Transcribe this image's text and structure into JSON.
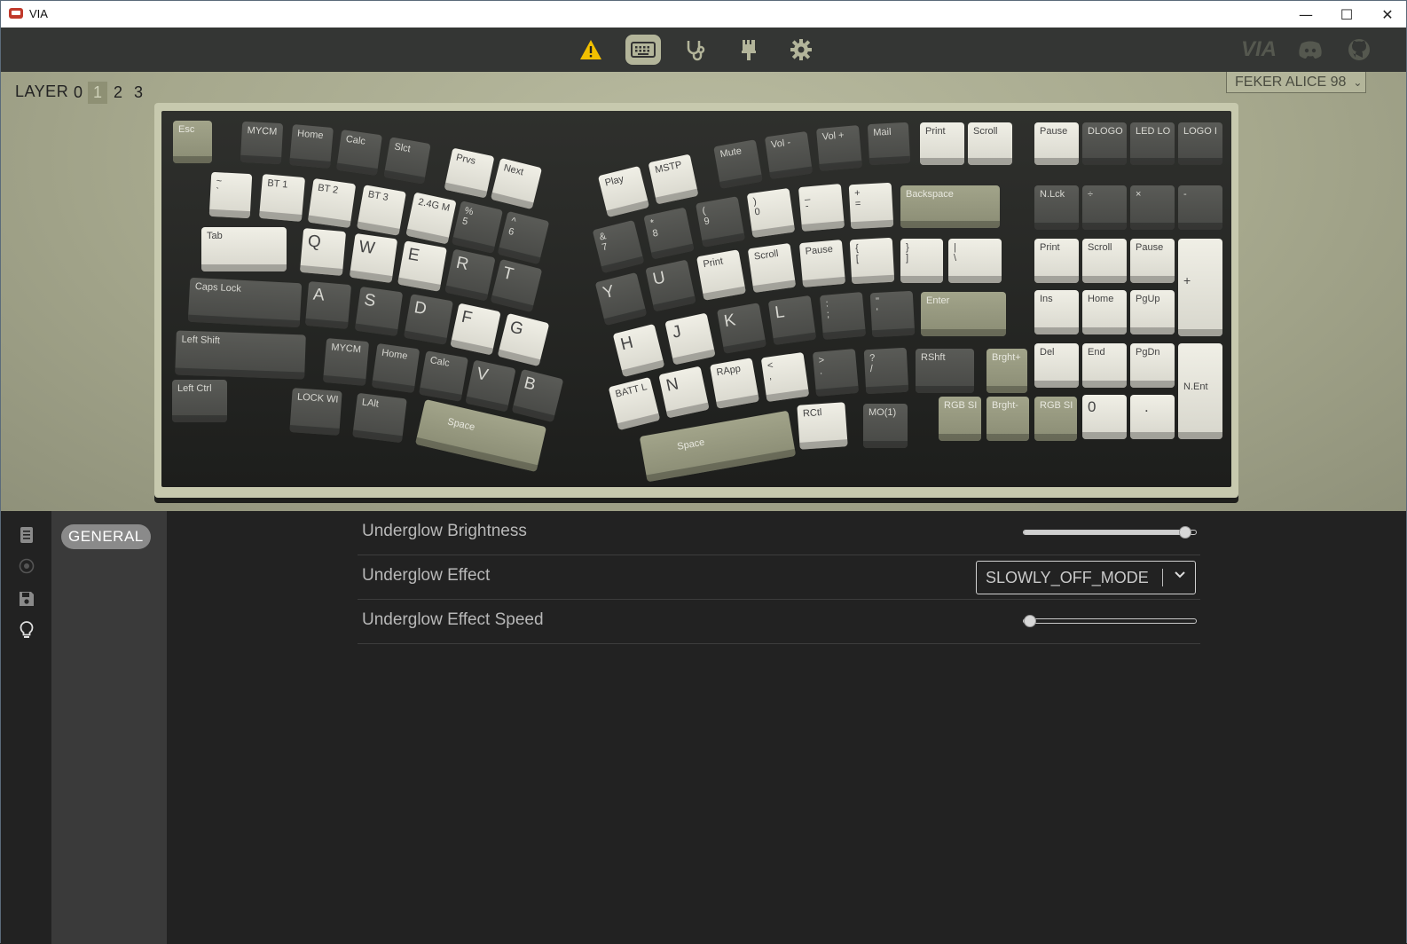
{
  "window": {
    "title": "VIA",
    "controls": {
      "minimize": "—",
      "maximize": "☐",
      "close": "✕"
    }
  },
  "topnav": {
    "brand_text": "VIA",
    "active_tab": "configure",
    "warning_color": "#f2c000"
  },
  "layers": {
    "label": "LAYER",
    "items": [
      "0",
      "1",
      "2",
      "3"
    ],
    "selected": "1"
  },
  "keyboard_selector": {
    "value": "FEKER ALICE 98",
    "chevron": "⌄"
  },
  "keys": {
    "esc": "Esc",
    "mycm": "MYCM",
    "home": "Home",
    "calc": "Calc",
    "slct": "Slct",
    "prvs": "Prvs",
    "next": "Next",
    "play": "Play",
    "mstp": "MSTP",
    "mute": "Mute",
    "vold": "Vol -",
    "volu": "Vol +",
    "mail": "Mail",
    "print": "Print",
    "scroll": "Scroll",
    "pause": "Pause",
    "dlogo": "DLOGO",
    "ledlo": "LED LO",
    "logo": "LOGO I",
    "tilde": "~\n`",
    "bt1": "BT 1",
    "bt2": "BT 2",
    "bt3": "BT 3",
    "g24": "2.4G M",
    "p5": "%\n5",
    "c6": "^\n6",
    "a7": "&\n7",
    "s8": "*\n8",
    "l9": "(\n9",
    "r0": ")\n0",
    "minus": "_\n-",
    "plus": "+\n=",
    "backspace": "Backspace",
    "nlck": "N.Lck",
    "div": "÷",
    "mul": "×",
    "sub": "-",
    "tab": "Tab",
    "q": "Q",
    "w": "W",
    "e": "E",
    "r": "R",
    "t": "T",
    "y": "Y",
    "u": "U",
    "print2": "Print",
    "scroll2": "Scroll",
    "pause2": "Pause",
    "lbr": "{\n[",
    "rbr": "}\n]",
    "bsl": "|\n\\",
    "np_print": "Print",
    "np_scroll": "Scroll",
    "np_pause": "Pause",
    "np_plus": "+",
    "caps": "Caps Lock",
    "a": "A",
    "s": "S",
    "d": "D",
    "f": "F",
    "g": "G",
    "h": "H",
    "j": "J",
    "k": "K",
    "l": "L",
    "semi": ":\n;",
    "quote": "\"\n'",
    "enter": "Enter",
    "ins": "Ins",
    "home2": "Home",
    "pgup": "PgUp",
    "lshift": "Left Shift",
    "mycm2": "MYCM",
    "home3": "Home",
    "calc2": "Calc",
    "v": "V",
    "b": "B",
    "battl": "BATT L",
    "n": "N",
    "rapp": "RApp",
    "lt": "<\n,",
    "gt": ">\n.",
    "qm": "?\n/",
    "rshft": "RShft",
    "brtup": "Brght+",
    "del": "Del",
    "end": "End",
    "pgdn": "PgDn",
    "nent": "N.Ent",
    "lctrl": "Left Ctrl",
    "lockwin": "LOCK WI",
    "lalt": "LAlt",
    "space": "Space",
    "space2": "Space",
    "rctl": "RCtl",
    "mo1": "MO(1)",
    "rgbsi": "RGB SI",
    "brtdn": "Brght-",
    "rgbsi2": "RGB SI",
    "zero": "0",
    "dot": "."
  },
  "menu": {
    "section": "GENERAL"
  },
  "settings": {
    "brightness": {
      "label": "Underglow Brightness",
      "value_fraction": 0.97
    },
    "effect": {
      "label": "Underglow Effect",
      "value": "SLOWLY_OFF_MODE"
    },
    "speed": {
      "label": "Underglow Effect Speed",
      "value_fraction": 0.0
    }
  }
}
